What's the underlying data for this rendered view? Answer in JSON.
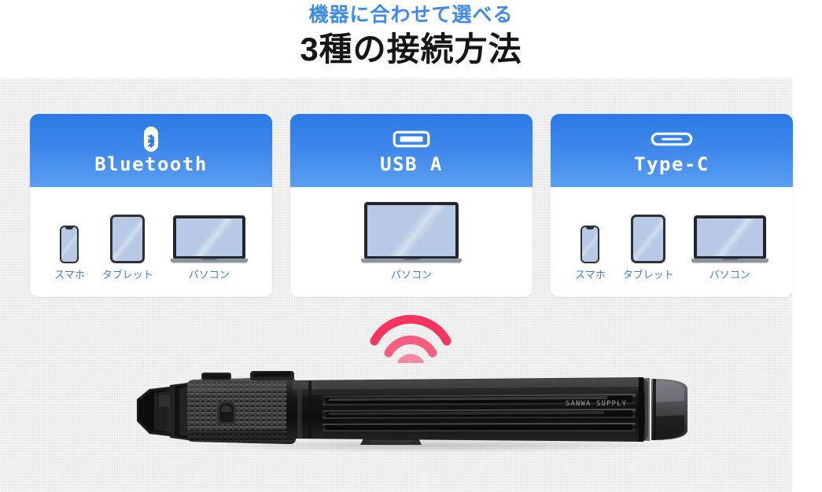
{
  "heading": {
    "sub": "機器に合わせて選べる",
    "main": "3種の接続方法"
  },
  "colors": {
    "accent_blue": "#3d8ae8",
    "header_blue_top": "#2a7ae6",
    "header_blue_bottom": "#5a9ef2",
    "label_blue": "#3f7fd1",
    "wifi_pink": "#f5355f",
    "panel_gray": "#ececec",
    "heading_dark": "#161616"
  },
  "cards": [
    {
      "title": "Bluetooth",
      "icon": "bluetooth-icon",
      "devices": [
        {
          "type": "phone",
          "label": "スマホ"
        },
        {
          "type": "tablet",
          "label": "タブレット"
        },
        {
          "type": "laptop",
          "label": "パソコン"
        }
      ]
    },
    {
      "title": "USB A",
      "icon": "usb-a-port-icon",
      "devices": [
        {
          "type": "laptop",
          "label": "パソコン"
        }
      ]
    },
    {
      "title": "Type-C",
      "icon": "usb-type-c-port-icon",
      "devices": [
        {
          "type": "phone",
          "label": "スマホ"
        },
        {
          "type": "tablet",
          "label": "タブレット"
        },
        {
          "type": "laptop",
          "label": "パソコン"
        }
      ]
    }
  ],
  "wireless_indicator": {
    "icon": "wifi-signal-icon",
    "arcs": 3
  },
  "product": {
    "name": "barcode-scanner",
    "brand_text": "SANWA SUPPLY"
  }
}
